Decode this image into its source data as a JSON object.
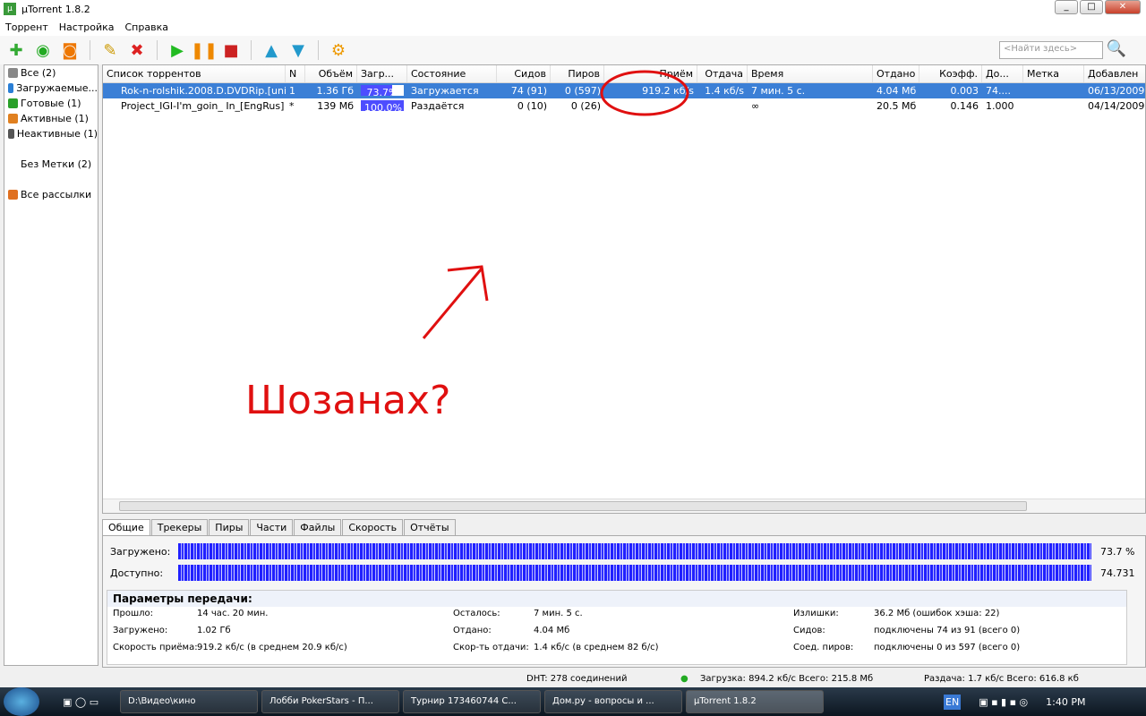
{
  "title": "µTorrent 1.8.2",
  "menu": [
    "Торрент",
    "Настройка",
    "Справка"
  ],
  "search_placeholder": "<Найти здесь>",
  "sidebar": [
    {
      "label": "Все (2)",
      "color": "#666"
    },
    {
      "label": "Загружаемые...",
      "color": "#2a7fd6"
    },
    {
      "label": "Готовые (1)",
      "color": "#2aa02a"
    },
    {
      "label": "Активные (1)",
      "color": "#e08020"
    },
    {
      "label": "Неактивные (1)",
      "color": "#444"
    },
    {
      "label": "Без Метки (2)",
      "color": ""
    },
    {
      "label": "Все рассылки",
      "color": "#e07020"
    }
  ],
  "columns": [
    "Список торрентов",
    "N",
    "Объём",
    "Загр...",
    "Состояние",
    "Сидов",
    "Пиров",
    "Приём",
    "Отдача",
    "Время",
    "Отдано",
    "Коэфф.",
    "До...",
    "Метка",
    "Добавлен"
  ],
  "rows": [
    {
      "name": "Rok-n-rolshik.2008.D.DVDRip.[uni...",
      "n": "1",
      "size": "1.36 Гб",
      "progress": "73.7%",
      "pct": 73.7,
      "status": "Загружается",
      "seeds": "74 (91)",
      "peers": "0 (597)",
      "down": "919.2 кб/s",
      "up": "1.4 кб/s",
      "eta": "7 мин. 5 с.",
      "uploaded": "4.04 Мб",
      "ratio": "0.003",
      "avail": "74....",
      "label": "",
      "added": "06/13/2009"
    },
    {
      "name": "Project_IGI-I'm_goin_ In_[EngRus]",
      "n": "*",
      "size": "139 Мб",
      "progress": "100.0%",
      "pct": 100,
      "status": "Раздаётся",
      "seeds": "0 (10)",
      "peers": "0 (26)",
      "down": "",
      "up": "",
      "eta": "∞",
      "uploaded": "20.5 Мб",
      "ratio": "0.146",
      "avail": "1.000",
      "label": "",
      "added": "04/14/2009"
    }
  ],
  "tabs": [
    "Общие",
    "Трекеры",
    "Пиры",
    "Части",
    "Файлы",
    "Скорость",
    "Отчёты"
  ],
  "bars": {
    "downloaded_label": "Загружено:",
    "downloaded_value": "73.7 %",
    "available_label": "Доступно:",
    "available_value": "74.731"
  },
  "params": {
    "title": "Параметры передачи:",
    "items": [
      [
        "Прошло:",
        "14 час. 20 мин."
      ],
      [
        "Загружено:",
        "1.02 Гб"
      ],
      [
        "Скорость приёма:",
        "919.2 кб/с (в среднем 20.9 кб/с)"
      ],
      [
        "Осталось:",
        "7 мин. 5 с."
      ],
      [
        "Отдано:",
        "4.04 Мб"
      ],
      [
        "Скор-ть отдачи:",
        "1.4 кб/с (в среднем 82 б/с)"
      ],
      [
        "Излишки:",
        "36.2 Мб (ошибок хэша: 22)"
      ],
      [
        "Сидов:",
        "подключены 74 из 91 (всего 0)"
      ],
      [
        "Соед. пиров:",
        "подключены 0 из 597 (всего 0)"
      ]
    ]
  },
  "status": {
    "dht": "DHT: 278 соединений",
    "download": "Загрузка: 894.2 кб/с Всего: 215.8 Мб",
    "upload": "Раздача: 1.7 кб/с Всего: 616.8 кб"
  },
  "taskbar": {
    "items": [
      "D:\\Видео\\кино",
      "Лобби PokerStars - П...",
      "Турнир 173460744 С...",
      "Дом.ру - вопросы и ...",
      "µTorrent 1.8.2"
    ],
    "lang": "EN",
    "clock": "1:40 PM"
  },
  "annotation": "Шозанах?"
}
